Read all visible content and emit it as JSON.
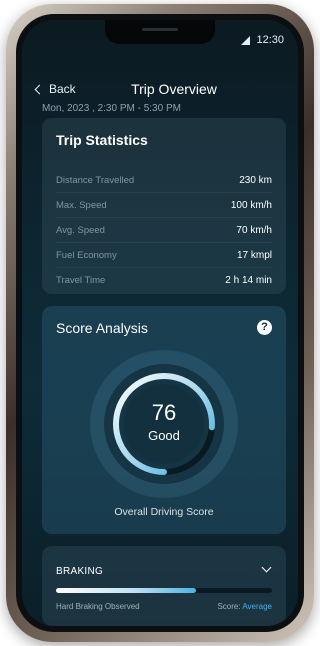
{
  "status_bar": {
    "time": "12:30"
  },
  "header": {
    "back_label": "Back",
    "title": "Trip Overview",
    "subtitle": "Mon, 2023 , 2:30 PM - 5:30 PM"
  },
  "trip_statistics": {
    "title": "Trip Statistics",
    "rows": [
      {
        "label": "Distance Travelled",
        "value": "230 km"
      },
      {
        "label": "Max. Speed",
        "value": "100 km/h"
      },
      {
        "label": "Avg. Speed",
        "value": "70 km/h"
      },
      {
        "label": "Fuel Economy",
        "value": "17 kmpl"
      },
      {
        "label": "Travel Time",
        "value": "2 h 14 min"
      }
    ]
  },
  "score_analysis": {
    "title": "Score Analysis",
    "help_icon": "question-circle-icon",
    "score": "76",
    "grade": "Good",
    "score_fraction": 0.76,
    "caption": "Overall Driving Score"
  },
  "braking": {
    "title": "BRAKING",
    "expand_icon": "chevron-down-icon",
    "progress_fraction": 0.65,
    "note": "Hard Braking Observed",
    "score_label": "Score:",
    "score_value": "Average"
  },
  "colors": {
    "accent": "#46b0e3",
    "background_top": "#0c1a22",
    "card": "#1e3844"
  }
}
